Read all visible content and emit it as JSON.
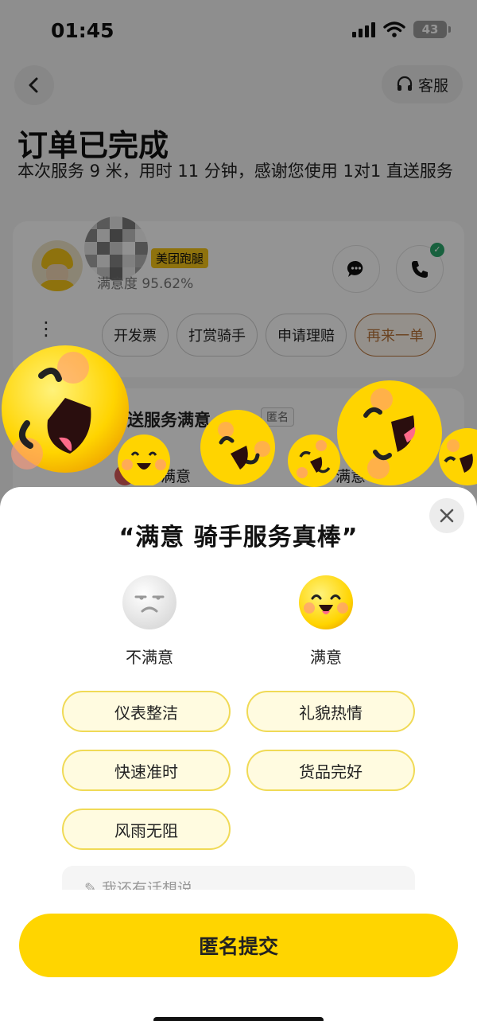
{
  "status_bar": {
    "time": "01:45",
    "battery": "43"
  },
  "header": {
    "back_icon": "chevron-left-icon",
    "service_label": "客服",
    "service_icon": "headset-icon"
  },
  "order": {
    "title": "订单已完成",
    "description": "本次服务 9 米，用时 11 分钟，感谢您使用 1对1 直送服务"
  },
  "rider": {
    "brand": "美团跑腿",
    "satisfaction": "满意度 95.62%",
    "actions": [
      "开发票",
      "打赏骑手",
      "申请理赔",
      "再来一单"
    ],
    "message_icon": "chat-bubble-icon",
    "phone_icon": "phone-icon"
  },
  "rating_card": {
    "title": "送服务满意",
    "anon_tag": "匿名",
    "option_a": "满意",
    "option_b": "满意"
  },
  "sheet": {
    "title": "“满意 骑手服务真棒”",
    "close_icon": "close-icon",
    "choices": [
      {
        "label": "不满意",
        "icon": "sad-face-icon"
      },
      {
        "label": "满意",
        "icon": "happy-face-icon"
      }
    ],
    "tags": [
      "仪表整洁",
      "礼貌热情",
      "快速准时",
      "货品完好",
      "风雨无阻"
    ],
    "comment_placeholder": "✎ 我还有话想说",
    "submit_label": "匿名提交"
  },
  "colors": {
    "accent_yellow": "#ffd500",
    "tag_border": "#f0da56",
    "tag_bg": "#fffbe0",
    "reorder_accent": "#b8743a"
  }
}
